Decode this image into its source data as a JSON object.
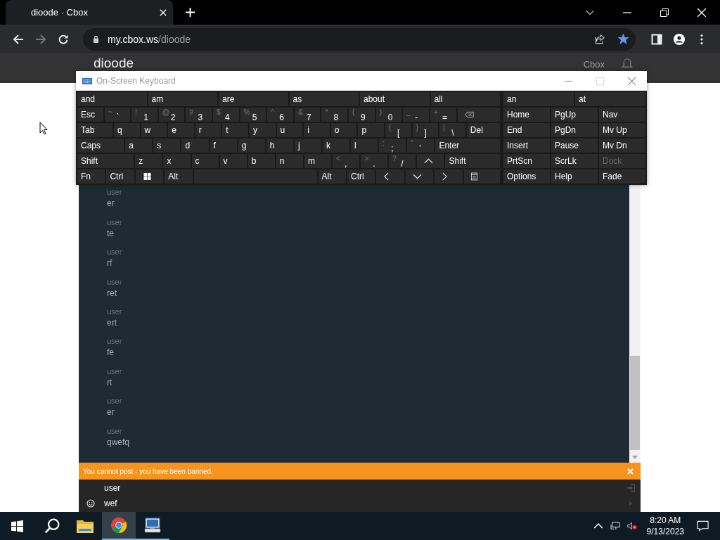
{
  "browser": {
    "tab_title": "dioode · Cbox",
    "url_host": "my.cbox.ws",
    "url_path": "/dioode",
    "forward_disabled": true,
    "bookmarked": true
  },
  "page": {
    "site_title": "dioode",
    "nav_link": "Cbox"
  },
  "keyboard": {
    "title": "On-Screen Keyboard",
    "suggestions": [
      "and",
      "am",
      "are",
      "as",
      "about",
      "all"
    ],
    "side_suggestions": [
      "an",
      "at"
    ],
    "rows": [
      {
        "keys": [
          {
            "kind": "key",
            "label": "Esc"
          },
          {
            "kind": "key",
            "label": "`",
            "shift": "~"
          },
          {
            "kind": "key",
            "label": "1",
            "shift": "!"
          },
          {
            "kind": "key",
            "label": "2",
            "shift": "@"
          },
          {
            "kind": "key",
            "label": "3",
            "shift": "#"
          },
          {
            "kind": "key",
            "label": "4",
            "shift": "$"
          },
          {
            "kind": "key",
            "label": "5",
            "shift": "%"
          },
          {
            "kind": "key",
            "label": "6",
            "shift": "^"
          },
          {
            "kind": "key",
            "label": "7",
            "shift": "&"
          },
          {
            "kind": "key",
            "label": "8",
            "shift": "*"
          },
          {
            "kind": "key",
            "label": "9",
            "shift": "("
          },
          {
            "kind": "key",
            "label": "0",
            "shift": ")"
          },
          {
            "kind": "key",
            "label": "-",
            "shift": "_"
          },
          {
            "kind": "key",
            "label": "=",
            "shift": "+"
          },
          {
            "kind": "backspace"
          }
        ]
      },
      {
        "keys": [
          {
            "kind": "key",
            "label": "Tab"
          },
          {
            "kind": "key",
            "label": "q"
          },
          {
            "kind": "key",
            "label": "w"
          },
          {
            "kind": "key",
            "label": "e"
          },
          {
            "kind": "key",
            "label": "r"
          },
          {
            "kind": "key",
            "label": "t"
          },
          {
            "kind": "key",
            "label": "y"
          },
          {
            "kind": "key",
            "label": "u"
          },
          {
            "kind": "key",
            "label": "i"
          },
          {
            "kind": "key",
            "label": "o"
          },
          {
            "kind": "key",
            "label": "p"
          },
          {
            "kind": "key",
            "label": "[",
            "shift": "{"
          },
          {
            "kind": "key",
            "label": "]",
            "shift": "}"
          },
          {
            "kind": "key",
            "label": "\\",
            "shift": "|"
          },
          {
            "kind": "key",
            "label": "Del"
          }
        ]
      },
      {
        "keys": [
          {
            "kind": "key",
            "label": "Caps"
          },
          {
            "kind": "key",
            "label": "a"
          },
          {
            "kind": "key",
            "label": "s"
          },
          {
            "kind": "key",
            "label": "d"
          },
          {
            "kind": "key",
            "label": "f"
          },
          {
            "kind": "key",
            "label": "g"
          },
          {
            "kind": "key",
            "label": "h"
          },
          {
            "kind": "key",
            "label": "j"
          },
          {
            "kind": "key",
            "label": "k"
          },
          {
            "kind": "key",
            "label": "l"
          },
          {
            "kind": "key",
            "label": ";",
            "shift": ":"
          },
          {
            "kind": "key",
            "label": "'",
            "shift": "\""
          },
          {
            "kind": "key",
            "label": "Enter"
          }
        ]
      },
      {
        "keys": [
          {
            "kind": "key",
            "label": "Shift"
          },
          {
            "kind": "key",
            "label": "z"
          },
          {
            "kind": "key",
            "label": "x"
          },
          {
            "kind": "key",
            "label": "c"
          },
          {
            "kind": "key",
            "label": "v"
          },
          {
            "kind": "key",
            "label": "b"
          },
          {
            "kind": "key",
            "label": "n"
          },
          {
            "kind": "key",
            "label": "m"
          },
          {
            "kind": "key",
            "label": ",",
            "shift": "<"
          },
          {
            "kind": "key",
            "label": ".",
            "shift": ">"
          },
          {
            "kind": "key",
            "label": "/",
            "shift": "?"
          },
          {
            "kind": "up"
          },
          {
            "kind": "key",
            "label": "Shift"
          }
        ]
      },
      {
        "keys": [
          {
            "kind": "key",
            "label": "Fn"
          },
          {
            "kind": "key",
            "label": "Ctrl"
          },
          {
            "kind": "windows"
          },
          {
            "kind": "key",
            "label": "Alt"
          },
          {
            "kind": "space"
          },
          {
            "kind": "key",
            "label": "Alt"
          },
          {
            "kind": "key",
            "label": "Ctrl"
          },
          {
            "kind": "left"
          },
          {
            "kind": "down"
          },
          {
            "kind": "right"
          },
          {
            "kind": "menu"
          }
        ]
      }
    ],
    "side_rows": [
      [
        {
          "label": "Home",
          "disabled": false
        },
        {
          "label": "PgUp",
          "disabled": false
        },
        {
          "label": "Nav",
          "disabled": false
        }
      ],
      [
        {
          "label": "End",
          "disabled": false
        },
        {
          "label": "PgDn",
          "disabled": false
        },
        {
          "label": "Mv Up",
          "disabled": false
        }
      ],
      [
        {
          "label": "Insert",
          "disabled": false
        },
        {
          "label": "Pause",
          "disabled": false
        },
        {
          "label": "Mv Dn",
          "disabled": false
        }
      ],
      [
        {
          "label": "PrtScn",
          "disabled": false
        },
        {
          "label": "ScrLk",
          "disabled": false
        },
        {
          "label": "Dock",
          "disabled": true
        }
      ],
      [
        {
          "label": "Options",
          "disabled": false
        },
        {
          "label": "Help",
          "disabled": false
        },
        {
          "label": "Fade",
          "disabled": false
        }
      ]
    ]
  },
  "chat": {
    "messages": [
      {
        "author": "user",
        "text": "er"
      },
      {
        "author": "user",
        "text": "te"
      },
      {
        "author": "user",
        "text": "rf"
      },
      {
        "author": "user",
        "text": "ret"
      },
      {
        "author": "user",
        "text": "ert"
      },
      {
        "author": "user",
        "text": "fe"
      },
      {
        "author": "user",
        "text": "rt"
      },
      {
        "author": "user",
        "text": "er"
      },
      {
        "author": "user",
        "text": "qwefq"
      }
    ],
    "banner": "You cannot post - you have been banned.",
    "name_value": "user",
    "message_value": "wef"
  },
  "taskbar": {
    "apps": [
      {
        "kind": "explorer",
        "open": false,
        "selected": false
      },
      {
        "kind": "chrome",
        "open": true,
        "selected": true
      },
      {
        "kind": "keyboard",
        "open": true,
        "selected": false
      }
    ],
    "volume_muted": true,
    "time": "8:20 AM",
    "date": "9/13/2023"
  }
}
